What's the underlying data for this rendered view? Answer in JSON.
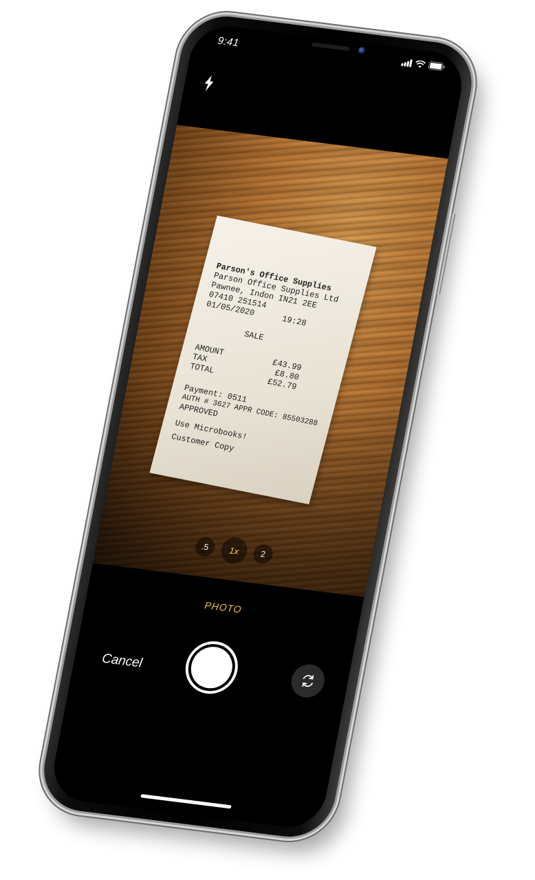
{
  "status_bar": {
    "time": "9:41",
    "icons": [
      "signal-icon",
      "wifi-icon",
      "battery-icon"
    ]
  },
  "camera": {
    "flash_icon": "flash-icon",
    "zoom_options": [
      ".5",
      "1x",
      "2"
    ],
    "active_zoom": "1x",
    "mode": "PHOTO",
    "cancel_label": "Cancel",
    "switch_camera_icon": "switch-camera-icon",
    "accent_color": "#f4c542"
  },
  "receipt": {
    "store_name": "Parson's Office Supplies",
    "company": "Parson Office Supplies Ltd",
    "address": "Pawnee, Indon IN21 2EE",
    "phone": "07410 251514",
    "date": "01/05/2020",
    "time": "19:28",
    "type": "SALE",
    "amount_label": "AMOUNT",
    "amount_value": "£43.99",
    "tax_label": "TAX",
    "tax_value": "£8.80",
    "total_label": "TOTAL",
    "total_value": "£52.79",
    "payment": "Payment: 0511",
    "auth": "AUTH # 3627",
    "appr_code": "APPR CODE: 85503288",
    "status": "APPROVED",
    "message": "Use Microbooks!",
    "copy": "Customer Copy"
  }
}
